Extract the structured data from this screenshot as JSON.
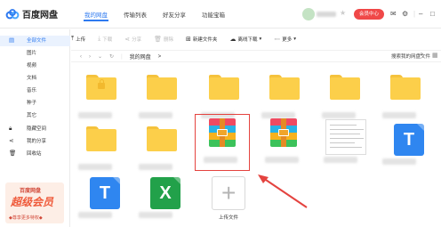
{
  "app": {
    "logo_text": "百度网盘",
    "nav_tabs": [
      "我的网盘",
      "传输列表",
      "好友分享",
      "功能宝箱"
    ],
    "vip_button": "会员中心",
    "icons": [
      "mail-icon",
      "gear-icon",
      "minimize-icon",
      "maximize-icon"
    ]
  },
  "sidebar": {
    "items": [
      {
        "label": "全部文件",
        "icon": "file-icon"
      },
      {
        "label": "图片"
      },
      {
        "label": "视频"
      },
      {
        "label": "文档"
      },
      {
        "label": "音乐"
      },
      {
        "label": "种子"
      },
      {
        "label": "其它"
      },
      {
        "label": "隐藏空间",
        "icon": "lock-icon"
      },
      {
        "label": "我的分享",
        "icon": "share-icon"
      },
      {
        "label": "回收站",
        "icon": "trash-icon"
      }
    ],
    "ad": {
      "line1": "百度网盘",
      "line2": "超级会员",
      "line3": "◆尊享更多特权◆"
    }
  },
  "toolbar": {
    "upload": "上传",
    "download": "下载",
    "share": "分享",
    "delete": "删除",
    "new_folder": "新建文件夹",
    "offline_download": "离线下载",
    "more": "更多"
  },
  "address": {
    "crumb": "我的网盘",
    "sep": ">",
    "search_placeholder": "搜索我的网盘文件"
  },
  "files": {
    "upload_label": "上传文件"
  },
  "colors": {
    "accent": "#2e7af0",
    "vip": "#f04848",
    "folder": "#fccf4a",
    "selection": "#e4433f"
  }
}
